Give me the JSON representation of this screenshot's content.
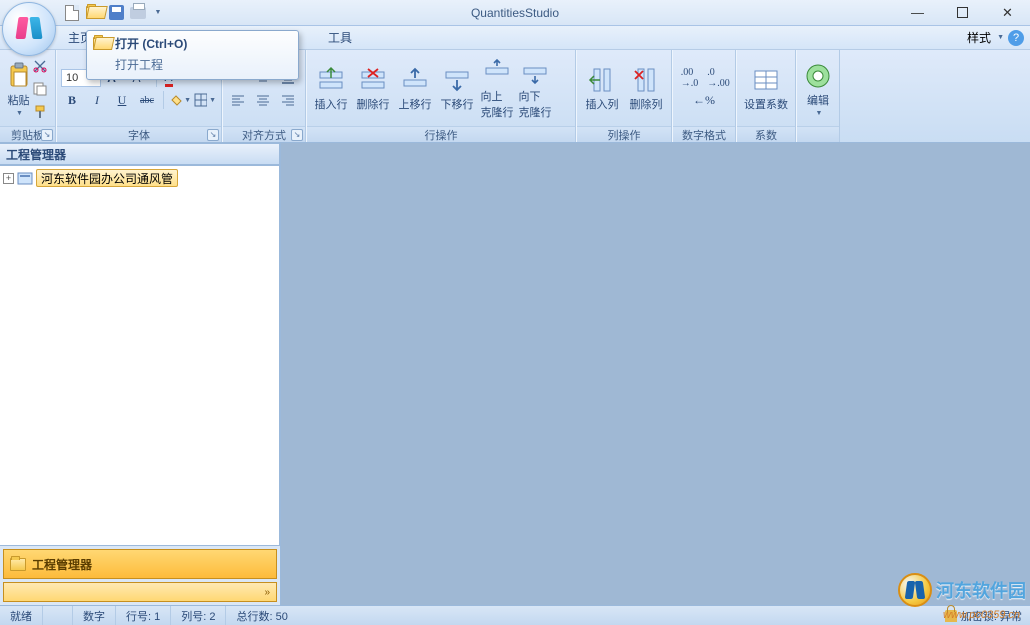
{
  "app": {
    "title": "QuantitiesStudio"
  },
  "qat": {
    "new": "new-doc-icon",
    "open": "folder-open-icon",
    "save": "save-icon",
    "print": "print-icon"
  },
  "menubar": {
    "items": [
      "主页",
      "工具"
    ],
    "style_label": "样式"
  },
  "tooltip": {
    "title": "打开 (Ctrl+O)",
    "subtitle": "打开工程"
  },
  "ribbon": {
    "clipboard": {
      "label": "剪贴板",
      "paste": "粘贴"
    },
    "font": {
      "label": "字体",
      "size": "10",
      "bold": "B",
      "italic": "I",
      "underline": "U",
      "strike": "abc",
      "grow": "A",
      "shrink": "A"
    },
    "align": {
      "label": "对齐方式"
    },
    "rowops": {
      "label": "行操作",
      "insert": "插入行",
      "delete": "删除行",
      "moveup": "上移行",
      "movedown": "下移行",
      "up": "向上",
      "down": "向下",
      "cloneup": "克隆行",
      "clonedown": "克隆行"
    },
    "colops": {
      "label": "列操作",
      "insertcol": "插入列",
      "deletecol": "删除列"
    },
    "numfmt": {
      "label": "数字格式"
    },
    "coef": {
      "label": "系数",
      "setcoef": "设置系数"
    },
    "edit": {
      "label": "",
      "btn": "编辑"
    }
  },
  "sidebar": {
    "title": "工程管理器",
    "item0": "河东软件园办公司通风管",
    "nav_title": "工程管理器",
    "collapse": "»"
  },
  "statusbar": {
    "ready": "就绪",
    "num": "数字",
    "row": "行号: 1",
    "col": "列号: 2",
    "total": "总行数: 50",
    "lock": "加密锁: 异常"
  },
  "watermark": {
    "text": "河东软件园",
    "url": "www.pc0359.cn"
  }
}
